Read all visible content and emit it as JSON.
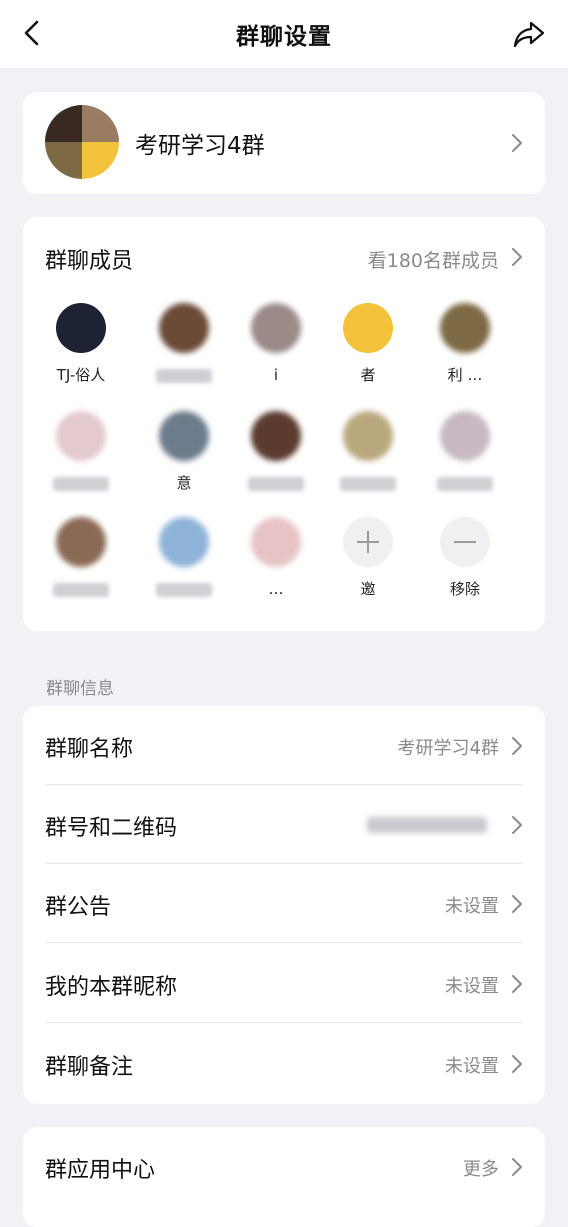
{
  "header": {
    "title": "群聊设置"
  },
  "group": {
    "name": "考研学习4群"
  },
  "members": {
    "title": "群聊成员",
    "count_text": "看180名群成员",
    "items": [
      {
        "name": "TJ-俗人",
        "color": "#1d2235"
      },
      {
        "name": "",
        "color": "#6b4a37"
      },
      {
        "name": "i",
        "color": "#9a8a88"
      },
      {
        "name": "者",
        "color": "#f2c23a"
      },
      {
        "name": "利 …",
        "color": "#7d6a44"
      },
      {
        "name": "",
        "color": "#e4c9cd"
      },
      {
        "name": "意",
        "color": "#6d7c8c"
      },
      {
        "name": "",
        "color": "#5a3b2e"
      },
      {
        "name": "",
        "color": "#b9a87d"
      },
      {
        "name": "",
        "color": "#c6b9c2"
      },
      {
        "name": "",
        "color": "#8b6a55"
      },
      {
        "name": "",
        "color": "#8fb3d8"
      },
      {
        "name": "…",
        "color": "#e7c3c6"
      },
      {
        "name": "邀",
        "color": "#f0f0f3"
      },
      {
        "name": "移除",
        "color": "#f0f0f3"
      }
    ]
  },
  "info_section_label": "群聊信息",
  "info": {
    "rows": [
      {
        "label": "群聊名称",
        "value": "考研学习4群"
      },
      {
        "label": "群号和二维码",
        "value": ""
      },
      {
        "label": "群公告",
        "value": "未设置"
      },
      {
        "label": "我的本群昵称",
        "value": "未设置"
      },
      {
        "label": "群聊备注",
        "value": "未设置"
      }
    ]
  },
  "apps": {
    "label": "群应用中心",
    "value": "更多"
  },
  "colors": {
    "background": "#f2f2f6",
    "card": "#ffffff",
    "secondary_text": "#8a8a8e"
  }
}
